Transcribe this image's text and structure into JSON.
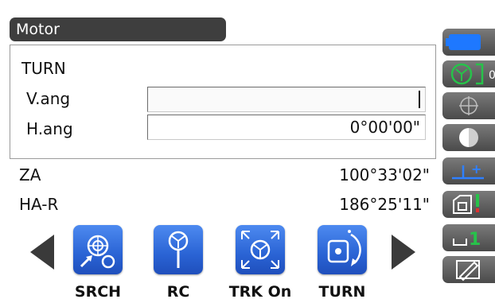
{
  "header": {
    "title": "Motor"
  },
  "panel": {
    "title": "TURN",
    "v_ang": {
      "label": "V.ang",
      "value": ""
    },
    "h_ang": {
      "label": "H.ang",
      "value": "0°00'00\""
    }
  },
  "measurements": [
    {
      "label": "ZA",
      "value": "100°33'02\""
    },
    {
      "label": "HA-R",
      "value": "186°25'11\""
    }
  ],
  "functions": [
    {
      "label": "SRCH",
      "icon": "search-prism-icon"
    },
    {
      "label": "RC",
      "icon": "prism-pole-icon"
    },
    {
      "label": "TRK On",
      "icon": "tracking-icon"
    },
    {
      "label": "TURN",
      "icon": "turn-icon"
    }
  ],
  "colors": {
    "accent": "#2a63d4",
    "battery": "#1e78ff",
    "status_green": "#27c24a",
    "title_bg": "#3e3e3e"
  },
  "status_icons": [
    "battery-icon",
    "prism-target-icon",
    "crosshair-icon",
    "half-circle-icon",
    "prism-constant-icon",
    "laser-plummet-icon",
    "input-mode-icon",
    "edit-icon"
  ],
  "status": {
    "prism_constant_symbol": "+",
    "input_mode": "1"
  }
}
